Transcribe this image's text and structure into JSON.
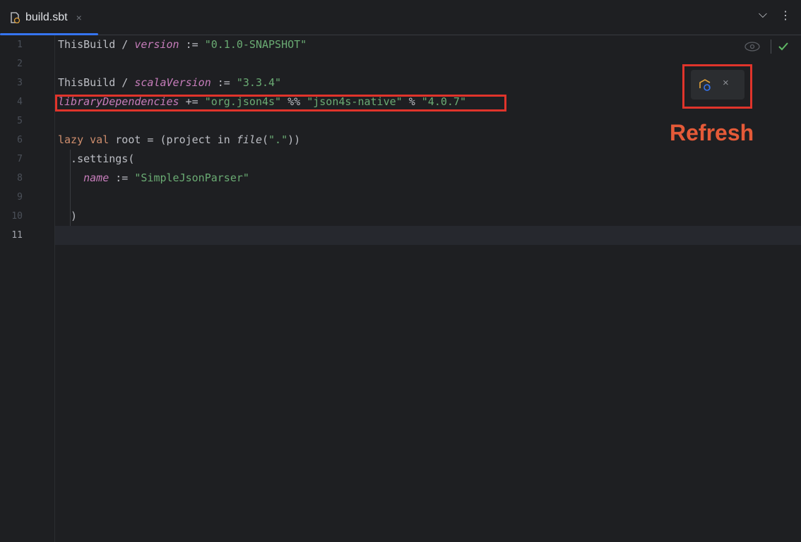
{
  "tab": {
    "filename": "build.sbt",
    "close_glyph": "×",
    "icon": "sbt-file-icon"
  },
  "tabbar_right": {
    "chevron": "⌵",
    "menu": "⋮"
  },
  "gutter": {
    "line_numbers": [
      "1",
      "2",
      "3",
      "4",
      "5",
      "6",
      "7",
      "8",
      "9",
      "10",
      "11"
    ],
    "current_line": "11"
  },
  "code": {
    "l1": {
      "a": "ThisBuild / ",
      "b": "version",
      "c": " := ",
      "d": "\"0.1.0-SNAPSHOT\""
    },
    "l3": {
      "a": "ThisBuild / ",
      "b": "scalaVersion",
      "c": " := ",
      "d": "\"3.3.4\""
    },
    "l4": {
      "a": "libraryDependencies",
      "b": " += ",
      "c": "\"org.json4s\"",
      "d": " %% ",
      "e": "\"json4s-native\"",
      "f": " % ",
      "g": "\"4.0.7\""
    },
    "l6": {
      "a": "lazy val",
      "b": " root = (project in ",
      "c": "file",
      "d": "(",
      "e": "\".\"",
      "f": "))"
    },
    "l7": {
      "a": "  .settings("
    },
    "l8": {
      "a": "    ",
      "b": "name",
      "c": " := ",
      "d": "\"SimpleJsonParser\""
    },
    "l10": {
      "a": "  )"
    }
  },
  "annotation": {
    "label": "Refresh",
    "close_glyph": "×"
  },
  "colors": {
    "accent": "#3574f0",
    "annotation": "#e0342b",
    "string": "#6aab73",
    "property": "#c77dbb",
    "keyword": "#cf8e6d",
    "ok": "#5fb865"
  }
}
